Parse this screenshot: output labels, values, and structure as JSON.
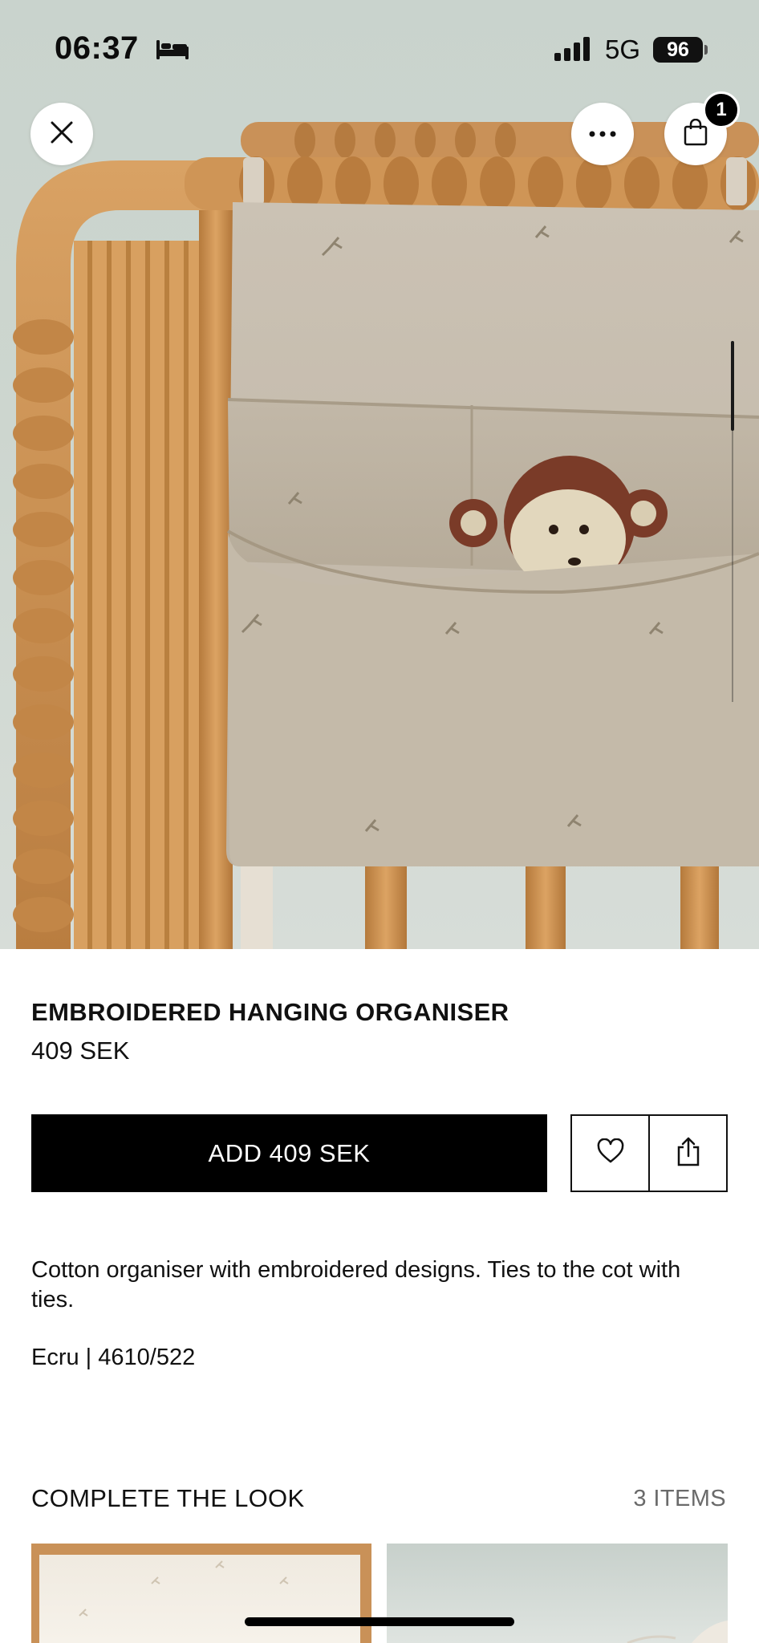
{
  "status_bar": {
    "time": "06:37",
    "sleep_icon": "bed-icon",
    "network": "5G",
    "battery": "96"
  },
  "overlay": {
    "close_icon": "close-icon",
    "more_icon": "ellipsis-icon",
    "bag_icon": "shopping-bag-icon",
    "bag_count": "1"
  },
  "product": {
    "name": "EMBROIDERED HANGING ORGANISER",
    "price": "409 SEK",
    "add_button": "ADD 409 SEK",
    "wishlist_icon": "heart-icon",
    "share_icon": "share-icon",
    "description": "Cotton organiser with embroidered designs. Ties to the cot with ties.",
    "colour_ref": "Ecru | 4610/522"
  },
  "complete_the_look": {
    "title": "COMPLETE THE LOOK",
    "count": "3 ITEMS"
  },
  "colors": {
    "primary": "#000000",
    "background": "#ffffff",
    "muted_text": "#6a6a6a"
  }
}
